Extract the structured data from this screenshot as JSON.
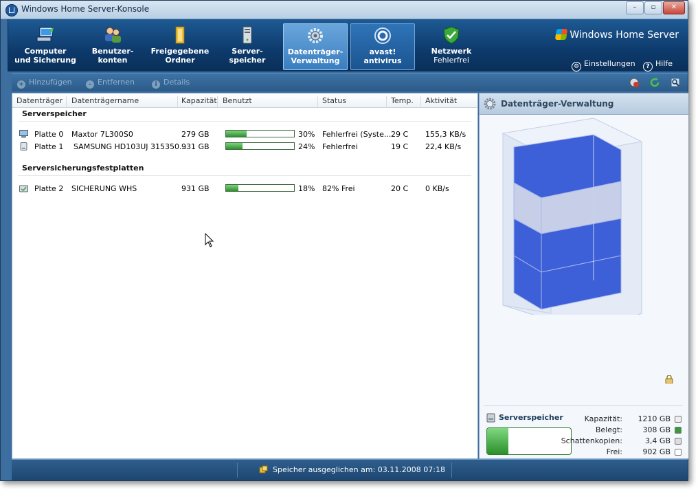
{
  "window": {
    "title": "Windows Home Server-Konsole"
  },
  "nav": {
    "items": [
      {
        "label": "Computer\nund Sicherung",
        "icon": "computer-icon"
      },
      {
        "label": "Benutzer-\nkonten",
        "icon": "users-icon"
      },
      {
        "label": "Freigegebene\nOrdner",
        "icon": "folder-icon"
      },
      {
        "label": "Server-\nspeicher",
        "icon": "server-icon"
      },
      {
        "label": "Datenträger-\nVerwaltung",
        "icon": "gear-icon",
        "active": true
      },
      {
        "label": "avast!\nantivirus",
        "icon": "avast-icon"
      }
    ],
    "network": {
      "label": "Netzwerk",
      "status": "Fehlerfrei"
    },
    "brand": "Windows Home Server",
    "settings": "Einstellungen",
    "help": "Hilfe"
  },
  "toolbar": {
    "add": "Hinzufügen",
    "remove": "Entfernen",
    "details": "Details"
  },
  "table": {
    "headers": [
      "Datenträger",
      "Datenträgername",
      "Kapazität",
      "Benutzt",
      "Status",
      "Temp.",
      "Aktivität"
    ],
    "groups": [
      {
        "title": "Serverspeicher",
        "rows": [
          {
            "disk": "Platte 0",
            "name": "Maxtor 7L300S0",
            "capacity": "279 GB",
            "used_pct": 30,
            "used": "30%",
            "status": "Fehlerfrei (Syste...",
            "temp": "29 C",
            "activity": "155,3 KB/s"
          },
          {
            "disk": "Platte 1",
            "name": "SAMSUNG HD103UJ 315350...",
            "capacity": "931 GB",
            "used_pct": 24,
            "used": "24%",
            "status": "Fehlerfrei",
            "temp": "19 C",
            "activity": "22,4 KB/s"
          }
        ]
      },
      {
        "title": "Serversicherungsfestplatten",
        "rows": [
          {
            "disk": "Platte 2",
            "name": "SICHERUNG WHS",
            "capacity": "931 GB",
            "used_pct": 18,
            "used": "18%",
            "status": "82% Frei",
            "temp": "20 C",
            "activity": "0 KB/s"
          }
        ]
      }
    ]
  },
  "panel": {
    "title": "Datenträger-Verwaltung",
    "summary": {
      "title": "Serverspeicher",
      "used_pct": 25,
      "stats": [
        {
          "label": "Kapazität:",
          "value": "1210 GB",
          "color": "#eeeeee"
        },
        {
          "label": "Belegt:",
          "value": "308 GB",
          "color": "#3a9a3a"
        },
        {
          "label": "Schattenkopien:",
          "value": "3,4 GB",
          "color": "#dddddd"
        },
        {
          "label": "Frei:",
          "value": "902 GB",
          "color": "#ffffff"
        }
      ]
    }
  },
  "statusbar": {
    "message": "Speicher ausgeglichen am: 03.11.2008 07:18"
  }
}
